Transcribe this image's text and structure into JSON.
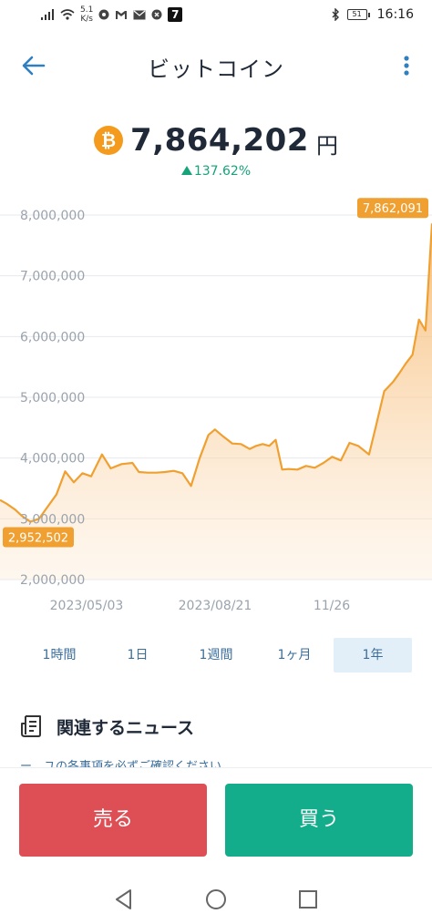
{
  "status_bar": {
    "net_speed_value": "5.1",
    "net_speed_unit": "K/s",
    "battery": "51",
    "time": "16:16",
    "notification_badge": "7",
    "icons": [
      "signal-icon",
      "wifi-icon",
      "app-icon",
      "gmail-icon",
      "mail-icon",
      "shield-icon",
      "bluetooth-icon",
      "battery-icon"
    ]
  },
  "header": {
    "title": "ビットコイン",
    "back_icon": "back-arrow-icon",
    "more_icon": "more-vertical-icon"
  },
  "price": {
    "coin_icon": "bitcoin-icon",
    "value": "7,864,202",
    "unit": "円",
    "change": "137.62%",
    "change_direction": "up"
  },
  "colors": {
    "accent": "#f0a030",
    "up": "#16a37a",
    "sell": "#de4f55",
    "buy": "#14ad8b",
    "tab_text": "#3b6e9b"
  },
  "chart_data": {
    "type": "area",
    "ylim": [
      2000000,
      8000000
    ],
    "y_ticks": [
      "2,000,000",
      "3,000,000",
      "4,000,000",
      "5,000,000",
      "6,000,000",
      "7,000,000",
      "8,000,000"
    ],
    "x_ticks": [
      "2023/05/03",
      "2023/08/21",
      "11/26"
    ],
    "grid": true,
    "series": [
      {
        "x": [
          0,
          3,
          7,
          10,
          14,
          18,
          21,
          26,
          30,
          34,
          38,
          42,
          47,
          51,
          56,
          61,
          64,
          68,
          72,
          76,
          80,
          84,
          88,
          92,
          96,
          99,
          103,
          107,
          111,
          115,
          118,
          121,
          124,
          127,
          130,
          133,
          137,
          141,
          145,
          149,
          153,
          157,
          161,
          165,
          170,
          173,
          177,
          181,
          184,
          187,
          190,
          193,
          196,
          199
        ],
        "values": [
          3310000,
          3250000,
          3150000,
          3050000,
          2952502,
          3000000,
          3150000,
          3400000,
          3780000,
          3600000,
          3750000,
          3700000,
          4060000,
          3830000,
          3900000,
          3920000,
          3770000,
          3760000,
          3760000,
          3770000,
          3790000,
          3750000,
          3540000,
          4000000,
          4380000,
          4470000,
          4350000,
          4240000,
          4230000,
          4150000,
          4200000,
          4230000,
          4200000,
          4300000,
          3810000,
          3820000,
          3810000,
          3870000,
          3840000,
          3920000,
          4020000,
          3960000,
          4250000,
          4200000,
          4060000,
          4500000,
          5100000,
          5250000,
          5400000,
          5560000,
          5700000,
          6280000,
          6100000,
          7862091
        ]
      }
    ],
    "annotations": [
      {
        "label": "2,952,502",
        "x": 14,
        "value": 2952502
      },
      {
        "label": "7,862,091",
        "x": 199,
        "value": 7862091
      }
    ]
  },
  "range_tabs": {
    "items": [
      {
        "label": "1時間",
        "active": false
      },
      {
        "label": "1日",
        "active": false
      },
      {
        "label": "1週間",
        "active": false
      },
      {
        "label": "1ヶ月",
        "active": false
      },
      {
        "label": "1年",
        "active": true
      }
    ]
  },
  "news": {
    "icon": "news-icon",
    "title": "関連するニュース",
    "snippet": "ー　ユの各事項を必ずご確認ください"
  },
  "actions": {
    "sell_label": "売る",
    "buy_label": "買う"
  },
  "nav": {
    "back_icon": "nav-back-icon",
    "home_icon": "nav-home-icon",
    "recents_icon": "nav-recents-icon"
  }
}
